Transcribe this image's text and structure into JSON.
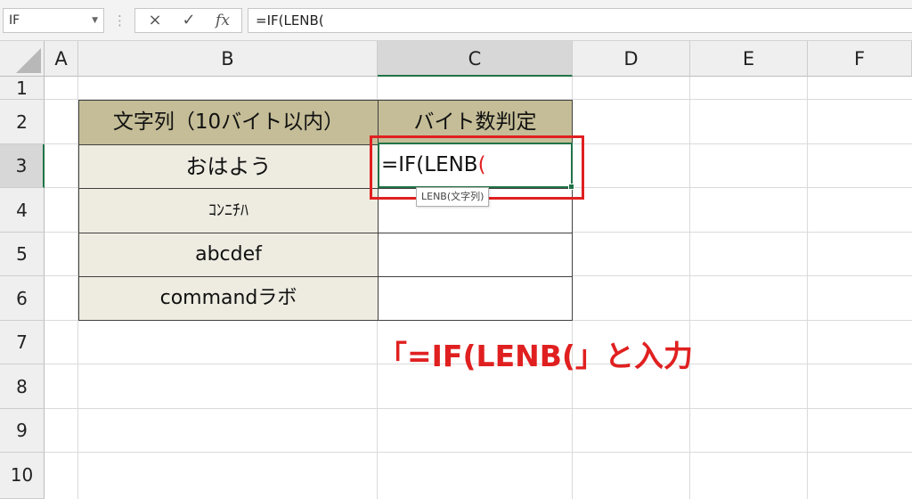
{
  "formula_bar": {
    "name_box": "IF",
    "cancel_icon": "×",
    "enter_icon": "✓",
    "fx_label": "fx",
    "formula": "=IF(LENB("
  },
  "columns": [
    "A",
    "B",
    "C",
    "D",
    "E",
    "F"
  ],
  "selected_column": "C",
  "rows": [
    "1",
    "2",
    "3",
    "4",
    "5",
    "6",
    "7",
    "8",
    "9",
    "10"
  ],
  "selected_row": "3",
  "table": {
    "header_b": "文字列（10バイト以内）",
    "header_c": "バイト数判定",
    "values_b": [
      "おはよう",
      "ｺﾝﾆﾁﾊ",
      "abcdef",
      "commandラボ"
    ]
  },
  "active_cell": {
    "text_black": "=IF(LENB",
    "text_red": "("
  },
  "tooltip": "LENB(文字列)",
  "instruction": "「=IF(LENB(」と入力",
  "colors": {
    "header_fill": "#c4bd97",
    "data_fill": "#eeece1",
    "accent_red": "#e02020",
    "excel_green": "#217346"
  }
}
